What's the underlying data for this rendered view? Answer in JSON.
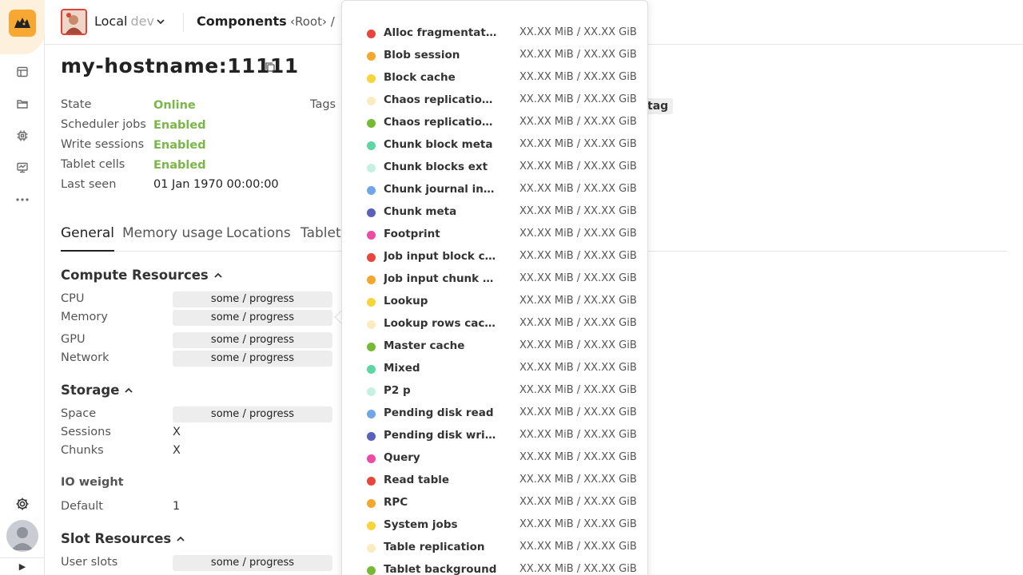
{
  "header": {
    "cluster_name": "Local",
    "cluster_env": "dev",
    "page": "Components",
    "breadcrumb": "‹Root›  /"
  },
  "node": {
    "title": "my-hostname:11111",
    "meta": [
      {
        "label": "State",
        "value": "Online"
      },
      {
        "label": "Scheduler jobs",
        "value": "Enabled"
      },
      {
        "label": "Write sessions",
        "value": "Enabled"
      },
      {
        "label": "Tablet cells",
        "value": "Enabled"
      },
      {
        "label": "Last seen",
        "value": "01 Jan 1970 00:00:00"
      }
    ],
    "tags_label": "Tags",
    "tag_chip": "tag"
  },
  "tabs": [
    "General",
    "Memory usage",
    "Locations",
    "Tablet"
  ],
  "compute": {
    "title": "Compute Resources",
    "rows": [
      {
        "label": "CPU",
        "value": "some / progress"
      },
      {
        "label": "Memory",
        "value": "some / progress"
      },
      {
        "label": "GPU",
        "value": "some / progress"
      },
      {
        "label": "Network",
        "value": "some / progress"
      }
    ]
  },
  "storage": {
    "title": "Storage",
    "space_label": "Space",
    "space_value": "some / progress",
    "sessions_label": "Sessions",
    "sessions_value": "X",
    "chunks_label": "Chunks",
    "chunks_value": "X"
  },
  "io": {
    "title": "IO weight",
    "default_label": "Default",
    "default_value": "1"
  },
  "slots": {
    "title": "Slot Resources",
    "user_slots_label": "User slots",
    "user_slots_value": "some / progress"
  },
  "memory_legend": [
    {
      "name": "Alloc fragmentation",
      "value": "XX.XX MiB / XX.XX GiB",
      "color": "#e8453c"
    },
    {
      "name": "Blob session",
      "value": "XX.XX MiB / XX.XX GiB",
      "color": "#f4a72c"
    },
    {
      "name": "Block cache",
      "value": "XX.XX MiB / XX.XX GiB",
      "color": "#f6d43a"
    },
    {
      "name": "Chaos replication incoming",
      "value": "XX.XX MiB / XX.XX GiB",
      "color": "#fbecc0"
    },
    {
      "name": "Chaos replication outgoing",
      "value": "XX.XX MiB / XX.XX GiB",
      "color": "#75b934"
    },
    {
      "name": "Chunk block meta",
      "value": "XX.XX MiB / XX.XX GiB",
      "color": "#5ed6a1"
    },
    {
      "name": "Chunk blocks ext",
      "value": "XX.XX MiB / XX.XX GiB",
      "color": "#c6f1e2"
    },
    {
      "name": "Chunk journal index",
      "value": "XX.XX MiB / XX.XX GiB",
      "color": "#6ea6e8"
    },
    {
      "name": "Chunk meta",
      "value": "XX.XX MiB / XX.XX GiB",
      "color": "#5b5fbe"
    },
    {
      "name": "Footprint",
      "value": "XX.XX MiB / XX.XX GiB",
      "color": "#ee4ba3"
    },
    {
      "name": "Job input block cache",
      "value": "XX.XX MiB / XX.XX GiB",
      "color": "#e8453c"
    },
    {
      "name": "Job input chunk meta",
      "value": "XX.XX MiB / XX.XX GiB",
      "color": "#f4a72c"
    },
    {
      "name": "Lookup",
      "value": "XX.XX MiB / XX.XX GiB",
      "color": "#f6d43a"
    },
    {
      "name": "Lookup rows cache",
      "value": "XX.XX MiB / XX.XX GiB",
      "color": "#fbecc0"
    },
    {
      "name": "Master cache",
      "value": "XX.XX MiB / XX.XX GiB",
      "color": "#75b934"
    },
    {
      "name": "Mixed",
      "value": "XX.XX MiB / XX.XX GiB",
      "color": "#5ed6a1"
    },
    {
      "name": "P2 p",
      "value": "XX.XX MiB / XX.XX GiB",
      "color": "#c6f1e2"
    },
    {
      "name": "Pending disk read",
      "value": "XX.XX MiB / XX.XX GiB",
      "color": "#6ea6e8"
    },
    {
      "name": "Pending disk write",
      "value": "XX.XX MiB / XX.XX GiB",
      "color": "#5b5fbe"
    },
    {
      "name": "Query",
      "value": "XX.XX MiB / XX.XX GiB",
      "color": "#ee4ba3"
    },
    {
      "name": "Read table",
      "value": "XX.XX MiB / XX.XX GiB",
      "color": "#e8453c"
    },
    {
      "name": "RPC",
      "value": "XX.XX MiB / XX.XX GiB",
      "color": "#f4a72c"
    },
    {
      "name": "System jobs",
      "value": "XX.XX MiB / XX.XX GiB",
      "color": "#f6d43a"
    },
    {
      "name": "Table replication",
      "value": "XX.XX MiB / XX.XX GiB",
      "color": "#fbecc0"
    },
    {
      "name": "Tablet background",
      "value": "XX.XX MiB / XX.XX GiB",
      "color": "#75b934"
    }
  ]
}
